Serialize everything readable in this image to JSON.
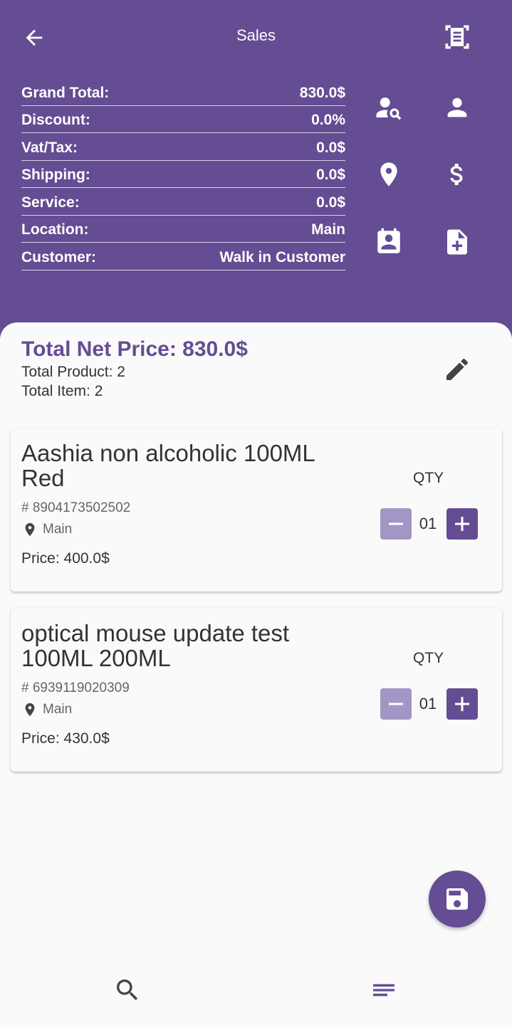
{
  "header": {
    "title": "Sales",
    "back_icon": "arrow-back-icon",
    "scan_icon": "document-scanner-icon"
  },
  "summary": [
    {
      "label": "Grand Total:",
      "value": "830.0$"
    },
    {
      "label": "Discount:",
      "value": "0.0%"
    },
    {
      "label": "Vat/Tax:",
      "value": "0.0$"
    },
    {
      "label": "Shipping:",
      "value": "0.0$"
    },
    {
      "label": "Service:",
      "value": "0.0$"
    },
    {
      "label": "Location:",
      "value": "Main"
    },
    {
      "label": "Customer:",
      "value": "Walk in Customer"
    }
  ],
  "header_actions": [
    "person-search-icon",
    "person-icon",
    "location-pin-icon",
    "dollar-icon",
    "contact-calendar-icon",
    "note-add-icon"
  ],
  "totals": {
    "net_price": "Total Net Price: 830.0$",
    "total_product": "Total Product: 2",
    "total_item": "Total Item: 2"
  },
  "products": [
    {
      "name": "Aashia non alcoholic 100ML Red",
      "sku": "# 8904173502502",
      "location": "Main",
      "price": "Price: 400.0$",
      "qty_label": "QTY",
      "qty": "01"
    },
    {
      "name": "optical mouse update test 100ML 200ML",
      "sku": "# 6939119020309",
      "location": "Main",
      "price": "Price: 430.0$",
      "qty_label": "QTY",
      "qty": "01"
    }
  ],
  "colors": {
    "primary": "#644d93",
    "minus_button": "#a496c4",
    "background": "#fafafa"
  },
  "fab_icon": "save-icon",
  "bottom_nav": [
    "search-icon",
    "menu-lines-icon"
  ]
}
